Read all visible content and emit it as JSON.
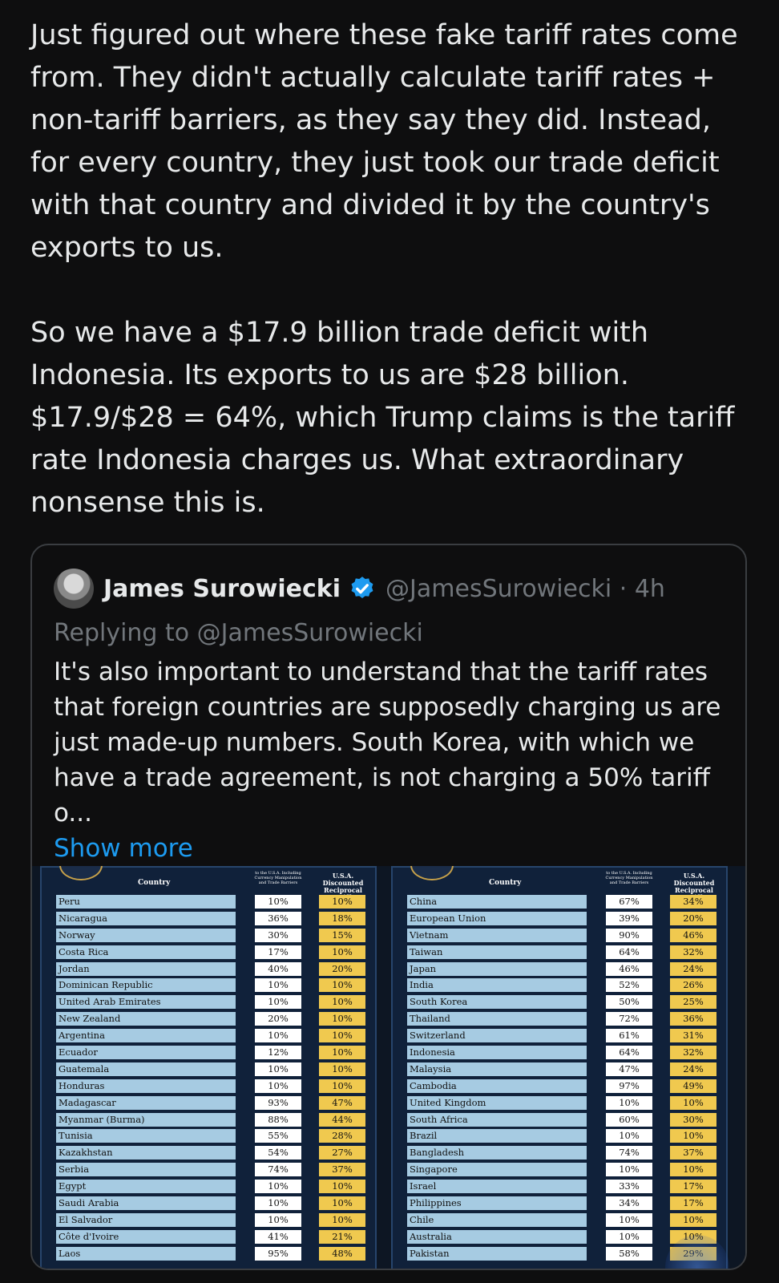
{
  "post": {
    "paragraph1": "Just figured out where these fake tariff rates come from. They didn't actually calculate tariff rates + non-tariff barriers, as they say they did. Instead, for every country, they just took our trade deficit with that country and divided it by the country's exports to us.",
    "paragraph2": "So we have a $17.9 billion trade deficit with Indonesia. Its exports to us are $28 billion. $17.9/$28 = 64%, which Trump claims is the tariff rate Indonesia charges us. What extraordinary nonsense this is."
  },
  "quote": {
    "author_name": "James Surowiecki",
    "handle_time": "@JamesSurowiecki · 4h",
    "replying_to": "Replying to @JamesSurowiecki",
    "body": "It's also important to understand that the tariff rates that foreign countries are supposedly charging us are just made-up numbers. South Korea, with which we have a trade agreement, is not charging a 50% tariff o...",
    "show_more": "Show more",
    "verified_icon": "verified-badge-icon",
    "colors": {
      "link": "#1d9bf0",
      "muted": "#71767b",
      "verified": "#1d9bf0"
    }
  },
  "tariff_tables": {
    "header_country": "Country",
    "header_rate": "to the U.S.A. Including Currency Manipulation and Trade Barriers",
    "header_reciprocal": "U.S.A. Discounted Reciprocal Tariffs",
    "left": [
      {
        "country": "Peru",
        "rate": "10%",
        "tariff": "10%"
      },
      {
        "country": "Nicaragua",
        "rate": "36%",
        "tariff": "18%"
      },
      {
        "country": "Norway",
        "rate": "30%",
        "tariff": "15%"
      },
      {
        "country": "Costa Rica",
        "rate": "17%",
        "tariff": "10%"
      },
      {
        "country": "Jordan",
        "rate": "40%",
        "tariff": "20%"
      },
      {
        "country": "Dominican Republic",
        "rate": "10%",
        "tariff": "10%"
      },
      {
        "country": "United Arab Emirates",
        "rate": "10%",
        "tariff": "10%"
      },
      {
        "country": "New Zealand",
        "rate": "20%",
        "tariff": "10%"
      },
      {
        "country": "Argentina",
        "rate": "10%",
        "tariff": "10%"
      },
      {
        "country": "Ecuador",
        "rate": "12%",
        "tariff": "10%"
      },
      {
        "country": "Guatemala",
        "rate": "10%",
        "tariff": "10%"
      },
      {
        "country": "Honduras",
        "rate": "10%",
        "tariff": "10%"
      },
      {
        "country": "Madagascar",
        "rate": "93%",
        "tariff": "47%"
      },
      {
        "country": "Myanmar (Burma)",
        "rate": "88%",
        "tariff": "44%"
      },
      {
        "country": "Tunisia",
        "rate": "55%",
        "tariff": "28%"
      },
      {
        "country": "Kazakhstan",
        "rate": "54%",
        "tariff": "27%"
      },
      {
        "country": "Serbia",
        "rate": "74%",
        "tariff": "37%"
      },
      {
        "country": "Egypt",
        "rate": "10%",
        "tariff": "10%"
      },
      {
        "country": "Saudi Arabia",
        "rate": "10%",
        "tariff": "10%"
      },
      {
        "country": "El Salvador",
        "rate": "10%",
        "tariff": "10%"
      },
      {
        "country": "Côte d'Ivoire",
        "rate": "41%",
        "tariff": "21%"
      },
      {
        "country": "Laos",
        "rate": "95%",
        "tariff": "48%"
      }
    ],
    "right": [
      {
        "country": "China",
        "rate": "67%",
        "tariff": "34%"
      },
      {
        "country": "European Union",
        "rate": "39%",
        "tariff": "20%"
      },
      {
        "country": "Vietnam",
        "rate": "90%",
        "tariff": "46%"
      },
      {
        "country": "Taiwan",
        "rate": "64%",
        "tariff": "32%"
      },
      {
        "country": "Japan",
        "rate": "46%",
        "tariff": "24%"
      },
      {
        "country": "India",
        "rate": "52%",
        "tariff": "26%"
      },
      {
        "country": "South Korea",
        "rate": "50%",
        "tariff": "25%"
      },
      {
        "country": "Thailand",
        "rate": "72%",
        "tariff": "36%"
      },
      {
        "country": "Switzerland",
        "rate": "61%",
        "tariff": "31%"
      },
      {
        "country": "Indonesia",
        "rate": "64%",
        "tariff": "32%"
      },
      {
        "country": "Malaysia",
        "rate": "47%",
        "tariff": "24%"
      },
      {
        "country": "Cambodia",
        "rate": "97%",
        "tariff": "49%"
      },
      {
        "country": "United Kingdom",
        "rate": "10%",
        "tariff": "10%"
      },
      {
        "country": "South Africa",
        "rate": "60%",
        "tariff": "30%"
      },
      {
        "country": "Brazil",
        "rate": "10%",
        "tariff": "10%"
      },
      {
        "country": "Bangladesh",
        "rate": "74%",
        "tariff": "37%"
      },
      {
        "country": "Singapore",
        "rate": "10%",
        "tariff": "10%"
      },
      {
        "country": "Israel",
        "rate": "33%",
        "tariff": "17%"
      },
      {
        "country": "Philippines",
        "rate": "34%",
        "tariff": "17%"
      },
      {
        "country": "Chile",
        "rate": "10%",
        "tariff": "10%"
      },
      {
        "country": "Australia",
        "rate": "10%",
        "tariff": "10%"
      },
      {
        "country": "Pakistan",
        "rate": "58%",
        "tariff": "29%"
      }
    ]
  }
}
